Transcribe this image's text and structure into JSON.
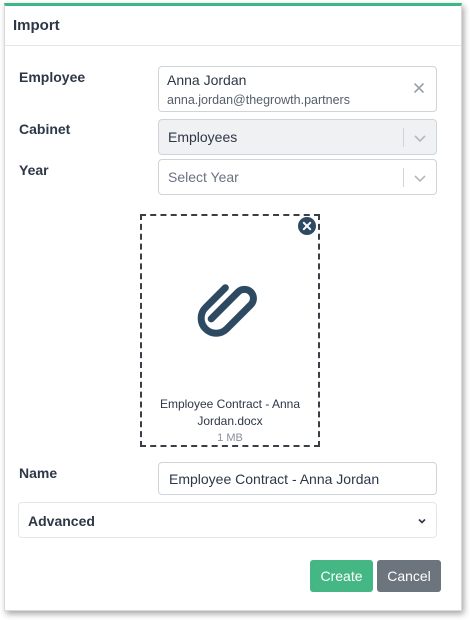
{
  "dialog": {
    "title": "Import"
  },
  "employee": {
    "label": "Employee",
    "name": "Anna Jordan",
    "email": "anna.jordan@thegrowth.partners"
  },
  "cabinet": {
    "label": "Cabinet",
    "value": "Employees"
  },
  "year": {
    "label": "Year",
    "placeholder": "Select Year"
  },
  "file": {
    "name": "Employee Contract - Anna Jordan.docx",
    "size": "1 MB",
    "icon": "paperclip-icon"
  },
  "name_field": {
    "label": "Name",
    "value": "Employee Contract - Anna Jordan"
  },
  "advanced": {
    "label": "Advanced"
  },
  "buttons": {
    "create": "Create",
    "cancel": "Cancel"
  },
  "colors": {
    "accent": "#3cb886",
    "create": "#44b784",
    "cancel": "#6c757d",
    "text": "#2d3748",
    "icon": "#2e4a62"
  }
}
